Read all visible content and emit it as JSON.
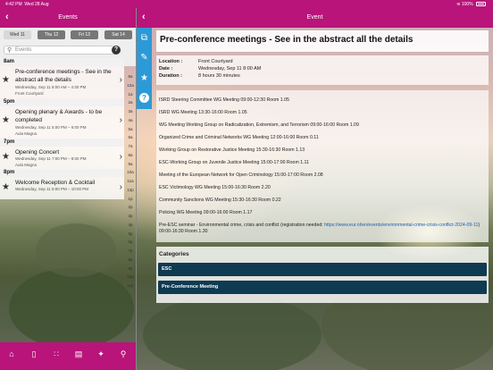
{
  "statusbar": {
    "time": "4:42 PM",
    "date": "Wed 28 Aug",
    "battery": "100%"
  },
  "left_nav": {
    "title": "Events",
    "back_icon": "chevron-left-icon"
  },
  "dates": [
    "Wed 11",
    "Thu 12",
    "Fri 13",
    "Sat 14"
  ],
  "search": {
    "placeholder": "Events"
  },
  "events": [
    {
      "header": "8am",
      "title": "Pre-conference meetings - See in the abstract all the details",
      "time": "Wednesday, Sep 11 8:00 AM – 4:30 PM",
      "location": "Front Courtyard"
    },
    {
      "header": "5pm",
      "title": "Opening plenary & Awards - to be completed",
      "time": "Wednesday, Sep 11 5:00 PM – 6:00 PM",
      "location": "Aula Magna"
    },
    {
      "header": "7pm",
      "title": "Opening Concert",
      "time": "Wednesday, Sep 11 7:00 PM – 8:00 PM",
      "location": "Aula Magna"
    },
    {
      "header": "8pm",
      "title": "Welcome Reception & Cocktail",
      "time": "Wednesday, Sep 11 8:00 PM – 10:00 PM",
      "location": ""
    }
  ],
  "time_index": [
    "6a",
    "12a",
    "1a",
    "2a",
    "3a",
    "4a",
    "5a",
    "6a",
    "7a",
    "8a",
    "9a",
    "10a",
    "11a",
    "12p",
    "1p",
    "2p",
    "3p",
    "4p",
    "5p",
    "6p",
    "7p",
    "8p",
    "9p",
    "10p",
    "11p"
  ],
  "tabbar": {
    "icons": [
      "home-icon",
      "phone-icon",
      "grid-icon",
      "presentation-icon",
      "map-icon",
      "search-icon"
    ]
  },
  "right_nav": {
    "title": "Event"
  },
  "side_tools": [
    "share-icon",
    "pencil-icon",
    "star-icon",
    "help-icon"
  ],
  "detail": {
    "title": "Pre-conference meetings - See in the abstract all the details",
    "location_label": "Location :",
    "location": "Front Courtyard",
    "date_label": "Date :",
    "date": "Wednesday, Sep 11 8:00 AM",
    "duration_label": "Duration :",
    "duration": "8 hours 30 minutes",
    "description": [
      "ISRD Steering Committee WG Meeting 09:00-12:30 Room 1.05",
      "ISRD WG Meeting 13:30-16:00 Room 1.05",
      "WG Meeting Working Group on Radicalization, Extremism, and Terrorism 09:00-16:00 Room 1.09",
      "Organized Crime and Criminal Networks WG Meeting 12:00-16:00 Room 0.11",
      "Working Group on Restorative Justice Meeting 15:30-16:30 Room 1.13",
      "ESC-Working Group on Juvenile Justice Meeting 15:00-17:00 Room 1.11",
      "Meeting of the European Network for Open Criminology 15:00-17:00 Room 2.08",
      "ESC Victimology WG Meeting 15:00-16:30 Room 2.20",
      "Community Sanctions WG Meeting 15:30-16:30 Room 0.22",
      "Policing WG Meeting 09:00-16:00 Room 1.17"
    ],
    "pre_esc_text": "Pre-ESC seminar - Environmental crime, crisis and conflict (registration needed: ",
    "pre_esc_link": "https://www.eur.nl/en/events/environmental-crime-crisis-conflict-2024-09-11",
    "pre_esc_tail": ") 09:00-16:30 Room 1.30",
    "categories_label": "Categories",
    "categories": [
      "ESC",
      "Pre-Conference Meeting"
    ]
  },
  "colors": {
    "brand": "#b8147a",
    "tool_blue": "#2c9ad7",
    "category_bg": "#0e3a52"
  }
}
